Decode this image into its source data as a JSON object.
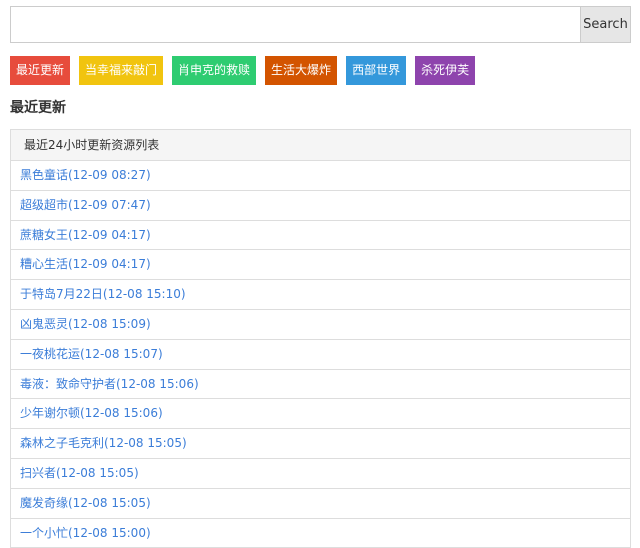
{
  "search": {
    "placeholder": "",
    "value": "",
    "button_label": "Search"
  },
  "categories": [
    {
      "label": "最近更新",
      "color": "#e74c3c"
    },
    {
      "label": "当幸福来敲门",
      "color": "#f1c40f"
    },
    {
      "label": "肖申克的救赎",
      "color": "#2ecc71"
    },
    {
      "label": "生活大爆炸",
      "color": "#d35400"
    },
    {
      "label": "西部世界",
      "color": "#3498db"
    },
    {
      "label": "杀死伊芙",
      "color": "#8e44ad"
    }
  ],
  "section": {
    "title": "最近更新"
  },
  "panel": {
    "header": "最近24小时更新资源列表",
    "items": [
      "黑色童话(12-09 08:27)",
      "超级超市(12-09 07:47)",
      "蔗糖女王(12-09 04:17)",
      "糟心生活(12-09 04:17)",
      "于特岛7月22日(12-08 15:10)",
      "凶鬼恶灵(12-08 15:09)",
      "一夜桃花运(12-08 15:07)",
      "毒液：致命守护者(12-08 15:06)",
      "少年谢尔顿(12-08 15:06)",
      "森林之子毛克利(12-08 15:05)",
      "扫兴者(12-08 15:05)",
      "魔发奇缘(12-08 15:05)",
      "一个小忙(12-08 15:00)"
    ]
  }
}
